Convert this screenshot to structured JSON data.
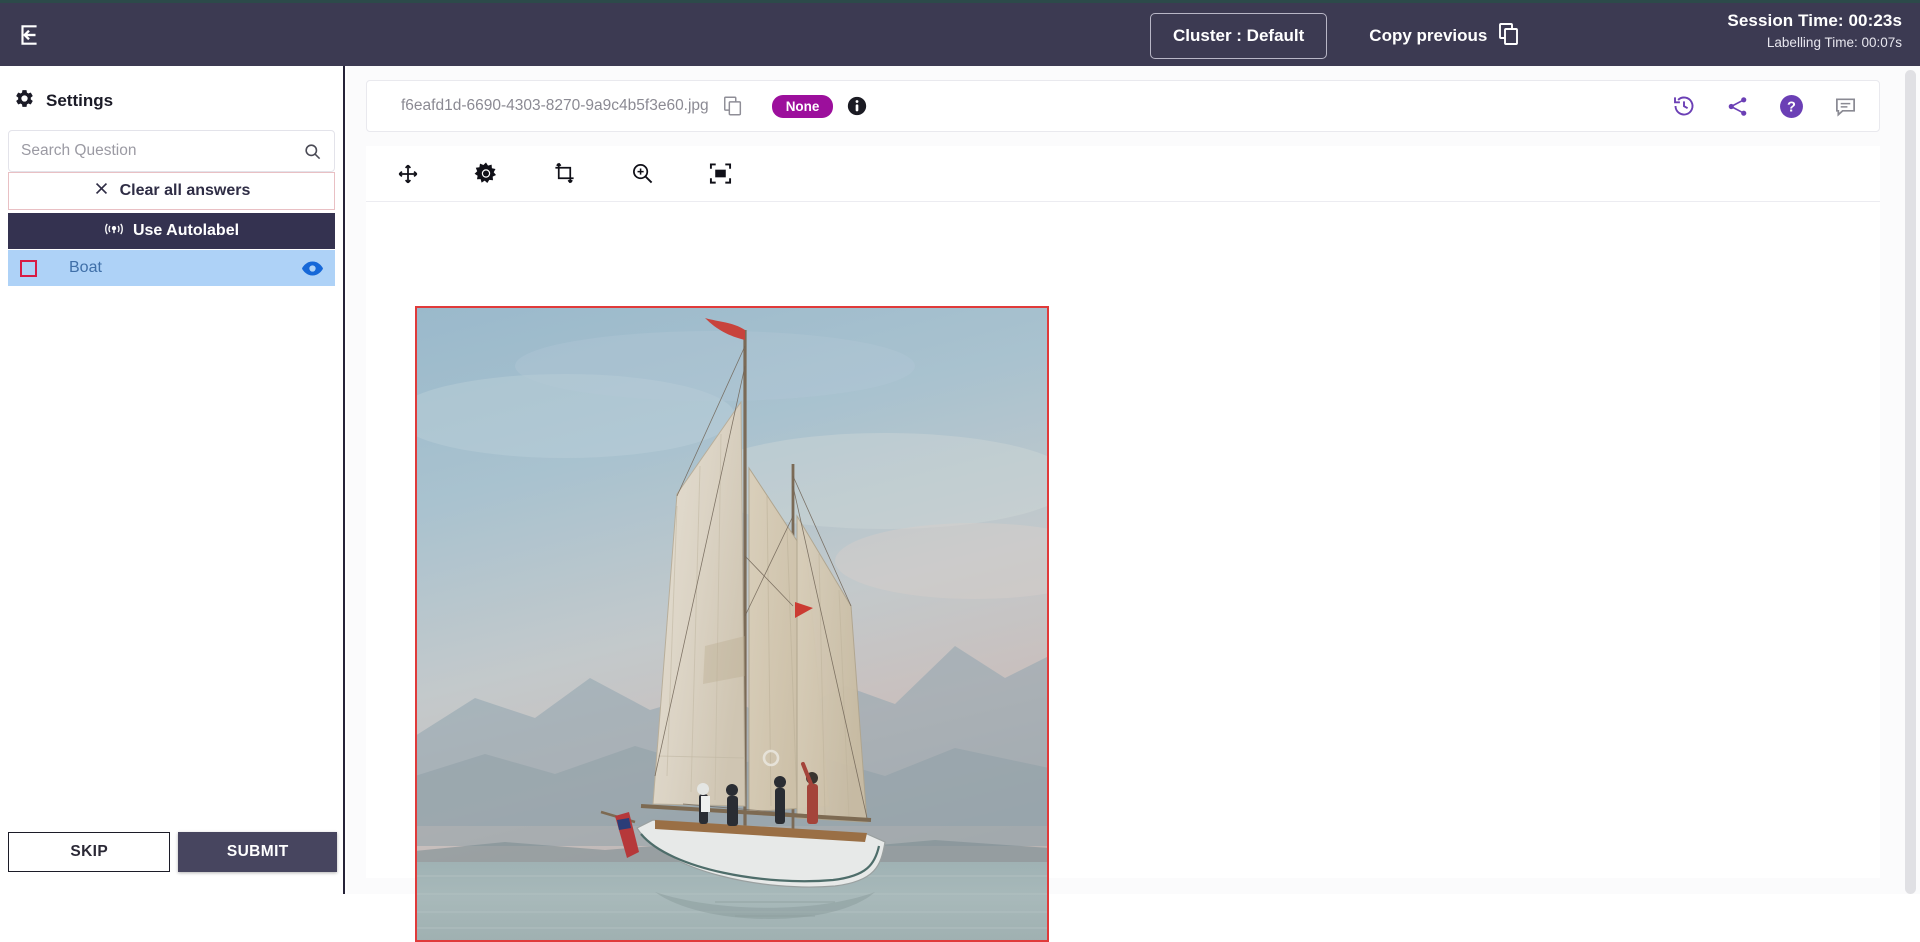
{
  "header": {
    "back_icon": "back-arrow-icon",
    "cluster_label": "Cluster : Default",
    "copy_previous_label": "Copy previous",
    "copy_previous_icon": "copy-icon",
    "session_time": "Session Time: 00:23s",
    "labelling_time": "Labelling Time: 00:07s"
  },
  "sidebar": {
    "settings_title": "Settings",
    "settings_icon": "gear-icon",
    "search": {
      "placeholder": "Search Question",
      "value": "",
      "icon": "search-icon"
    },
    "clear_all_label": "Clear all answers",
    "clear_all_icon": "close-x-icon",
    "autolabel_label": "Use Autolabel",
    "autolabel_icon": "broadcast-icon",
    "labels": [
      {
        "name": "Boat",
        "swatch_color": "#d81b44",
        "visibility_icon": "eye-icon",
        "selected": true
      }
    ],
    "skip_label": "SKIP",
    "submit_label": "SUBMIT"
  },
  "main": {
    "file": {
      "name": "f6eafd1d-6690-4303-8270-9a9c4b5f3e60.jpg",
      "copy_icon": "copy-icon",
      "status_badge": "None",
      "status_badge_color": "#9c0f9c",
      "info_icon": "info-icon"
    },
    "card_actions": [
      {
        "icon": "history-icon"
      },
      {
        "icon": "share-icon"
      },
      {
        "icon": "help-circle-icon"
      },
      {
        "icon": "comment-icon"
      }
    ],
    "tools": [
      {
        "icon": "move-icon"
      },
      {
        "icon": "brightness-icon"
      },
      {
        "icon": "crop-icon"
      },
      {
        "icon": "zoom-in-icon"
      },
      {
        "icon": "fit-to-screen-icon"
      }
    ],
    "annotation": {
      "bbox_color": "#e03a3a",
      "image_subject": "sailboat-photo"
    }
  },
  "colors": {
    "topbar": "#3c3a52",
    "accent_dark": "#343250",
    "selection_blue": "#aed2f7",
    "action_purple": "#6b3fb5"
  }
}
